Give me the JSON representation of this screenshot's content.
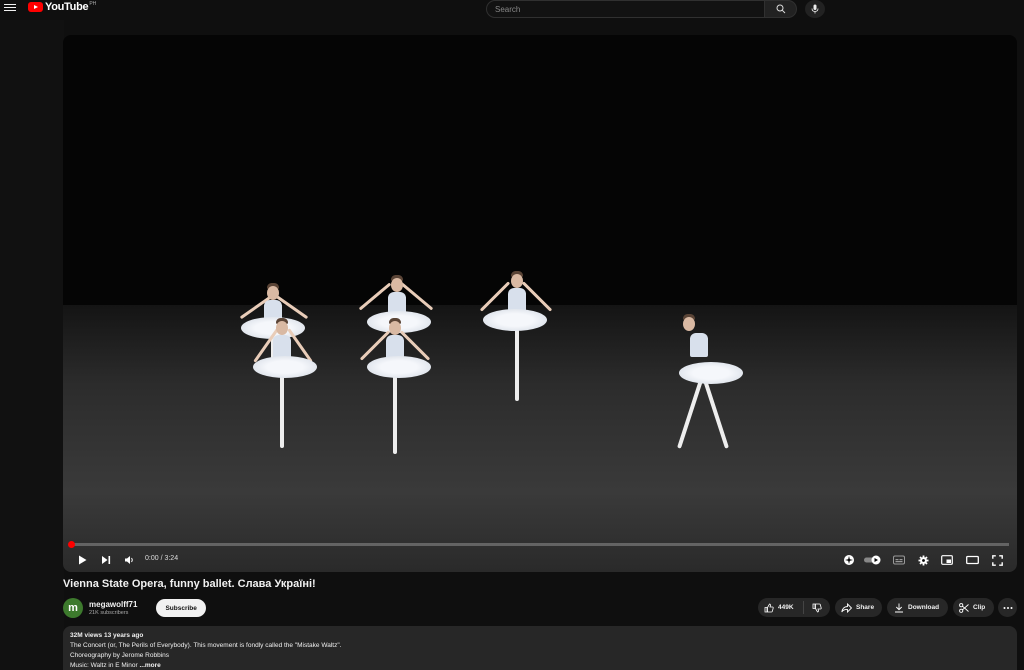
{
  "header": {
    "logo_text": "YouTube",
    "logo_region": "PH",
    "search_placeholder": "Search"
  },
  "player": {
    "time": "0:00 / 3:24",
    "progress": 0
  },
  "video": {
    "title": "Vienna State Opera, funny ballet. Слава Україні!"
  },
  "channel": {
    "avatar_letter": "m",
    "name": "megawolff71",
    "subscribers": "21K subscribers",
    "subscribe_label": "Subscribe"
  },
  "actions": {
    "likes": "449K",
    "share_label": "Share",
    "download_label": "Download",
    "clip_label": "Clip"
  },
  "description": {
    "meta": "32M views  13 years ago",
    "line1": "The Concert (or, The Perils of Everybody). This movement is fondly called the \"Mistake Waltz\".",
    "line2": "Choreography by Jerome Robbins",
    "line3": "Music: Waltz in E Minor",
    "more_label": "...more"
  },
  "colors": {
    "accent": "#ff0000",
    "background": "#0f0f0f",
    "pill": "#272727"
  }
}
